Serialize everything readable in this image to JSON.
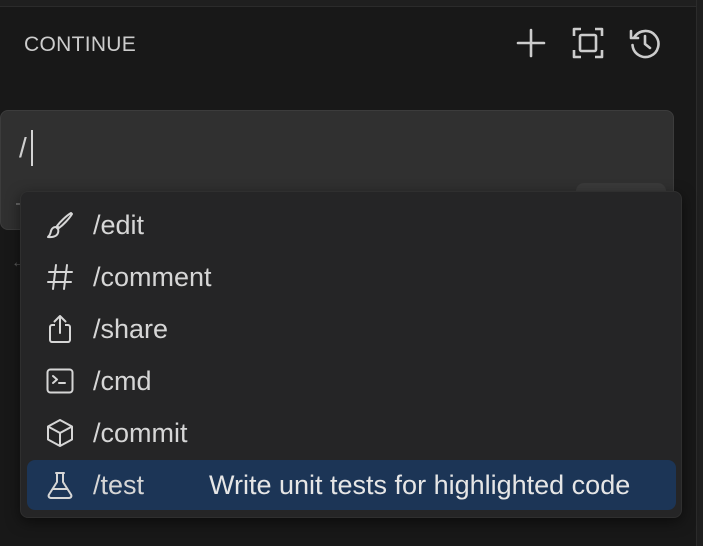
{
  "panel": {
    "title": "CONTINUE",
    "actions": [
      {
        "name": "new-session",
        "icon": "plus-icon"
      },
      {
        "name": "fullscreen",
        "icon": "fullscreen-icon"
      },
      {
        "name": "history",
        "icon": "history-icon"
      }
    ]
  },
  "input": {
    "value": "/"
  },
  "slash_menu": {
    "items": [
      {
        "label": "/edit",
        "icon": "paintbrush-icon",
        "description": ""
      },
      {
        "label": "/comment",
        "icon": "hash-icon",
        "description": ""
      },
      {
        "label": "/share",
        "icon": "share-icon",
        "description": ""
      },
      {
        "label": "/cmd",
        "icon": "terminal-icon",
        "description": ""
      },
      {
        "label": "/commit",
        "icon": "cube-icon",
        "description": ""
      },
      {
        "label": "/test",
        "icon": "beaker-icon",
        "description": "Write unit tests for highlighted code",
        "selected": true
      }
    ]
  },
  "colors": {
    "background": "#181818",
    "input_background": "#303030",
    "menu_background": "#252526",
    "selected_item": "#1c3556",
    "text": "#d6d6d6"
  }
}
